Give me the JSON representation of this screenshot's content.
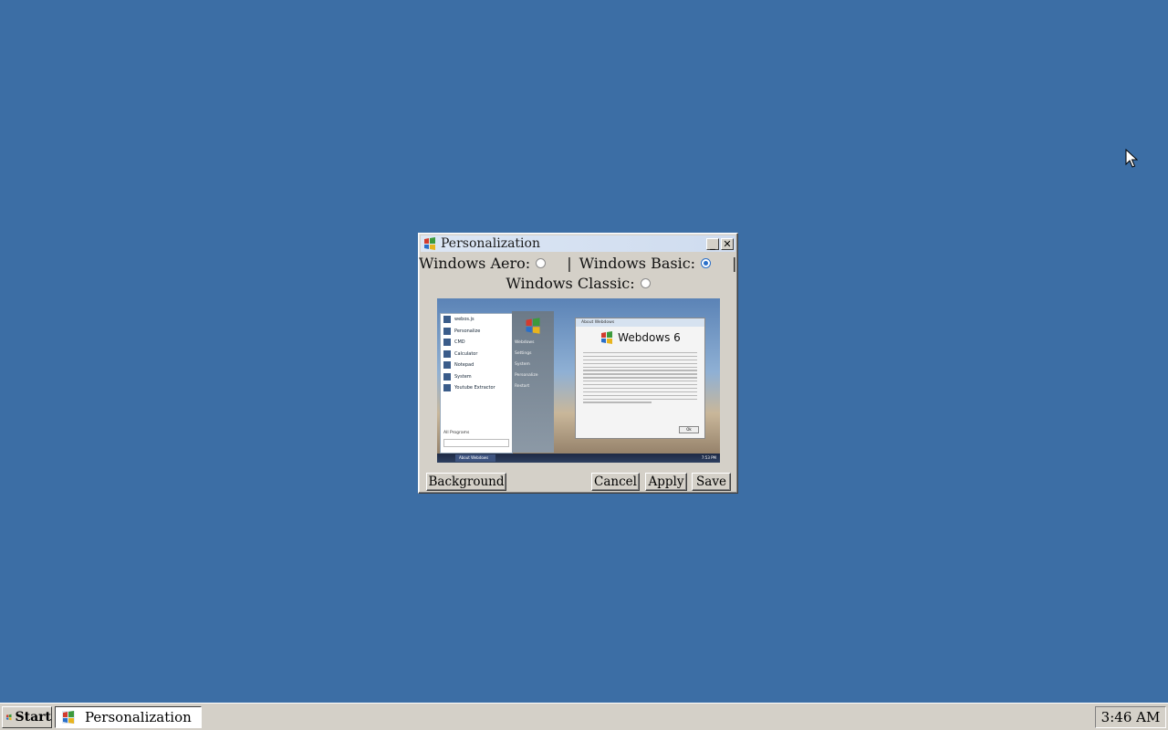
{
  "window": {
    "title": "Personalization",
    "minimize_label": "_",
    "close_label": "✕",
    "options": {
      "aero_label": "Windows Aero:",
      "aero_selected": false,
      "separator_1": "|",
      "basic_label": "Windows Basic:",
      "basic_selected": true,
      "separator_2": "|",
      "classic_label": "Windows Classic:",
      "classic_selected": false
    },
    "buttons": {
      "background_label": "Background",
      "cancel_label": "Cancel",
      "apply_label": "Apply",
      "save_label": "Save"
    },
    "preview": {
      "start_items": [
        "webos.js",
        "Personalize",
        "CMD",
        "Calculator",
        "Notepad",
        "System",
        "Youtube Extractor"
      ],
      "all_programs": "All Programs",
      "right_items": [
        "Webdows",
        "Settings",
        "System",
        "Personalize",
        "Restart"
      ],
      "about_title": "About Webdows",
      "about_name": "Webdows 6",
      "ok_label": "Ok",
      "task_label": "About Webdows",
      "clock": "7:53 PM"
    }
  },
  "taskbar": {
    "start_label": "Start",
    "task_label": "Personalization",
    "clock": "3:46 AM"
  },
  "colors": {
    "desktop": "#3c6ea5",
    "chrome": "#d4d0c8",
    "radio_accent": "#2a6fc9"
  }
}
